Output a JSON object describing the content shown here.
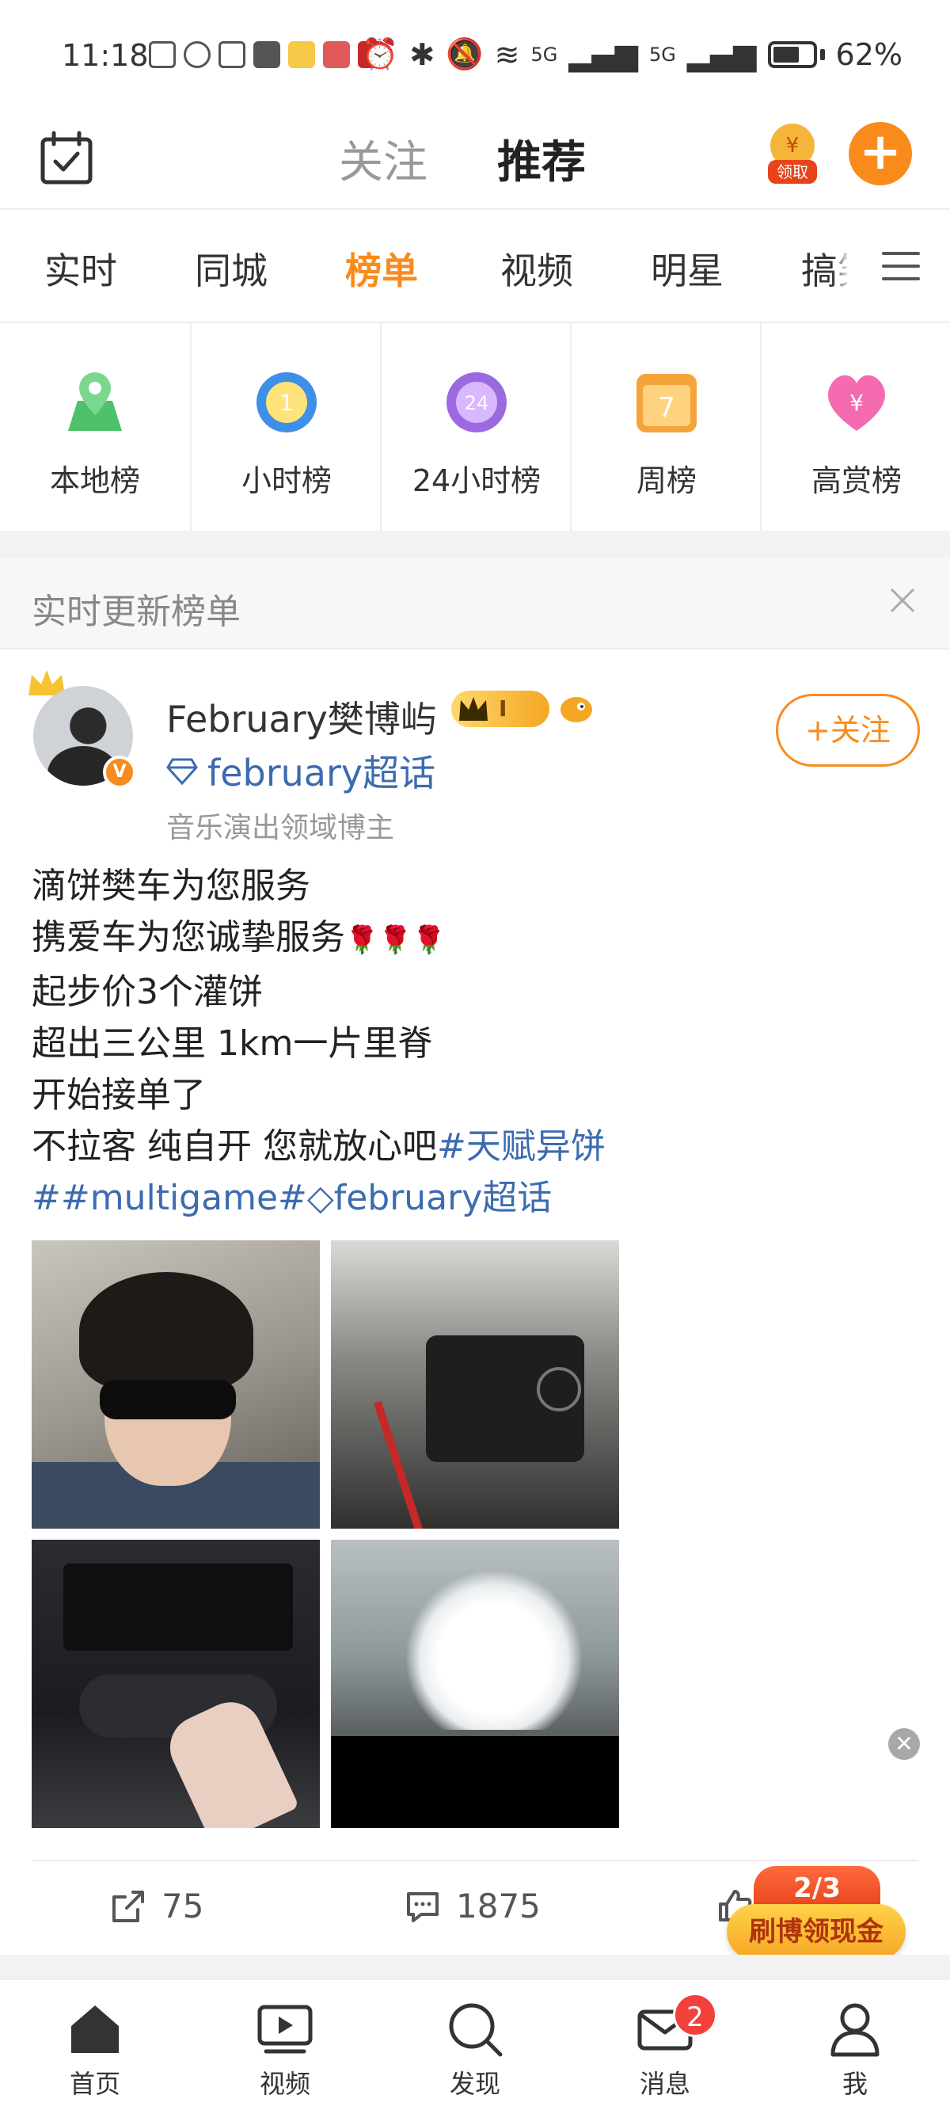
{
  "status_bar": {
    "time": "11:18",
    "battery": "62%",
    "signal1": "5G",
    "signal2": "5G"
  },
  "header": {
    "tab_follow": "关注",
    "tab_recommend": "推荐",
    "coin_label": "领取",
    "accent_color": "#f98b1d"
  },
  "categories": [
    "实时",
    "同城",
    "榜单",
    "视频",
    "明星",
    "搞笑"
  ],
  "active_category": "榜单",
  "ranks": [
    {
      "label": "本地榜",
      "icon": "location-pin-icon"
    },
    {
      "label": "小时榜",
      "icon": "hour-clock-icon"
    },
    {
      "label": "24小时榜",
      "icon": "24h-clock-icon"
    },
    {
      "label": "周榜",
      "icon": "calendar-7-icon"
    },
    {
      "label": "高赏榜",
      "icon": "heart-yen-icon"
    }
  ],
  "realtime": {
    "title": "实时更新榜单"
  },
  "post": {
    "author": "February樊博屿",
    "level_badge": "I",
    "supertopic": "february超话",
    "meta": "音乐演出领域博主",
    "follow_label": "+关注",
    "text_lines": [
      "滴饼樊车为您服务",
      "携爱车为您诚挚服务",
      "起步价3个灌饼",
      "超出三公里 1km一片里脊",
      "开始接单了",
      "不拉客 纯自开 您就放心吧"
    ],
    "topic1": "#天赋异饼",
    "topic2": "##multigame#",
    "topic3": "february超话",
    "images": [
      "selfie-photo",
      "engine-photo",
      "car-dashboard-photo",
      "dog-photo"
    ]
  },
  "actions": {
    "repost_count": "75",
    "comment_count": "1875"
  },
  "promo": {
    "progress": "2/3",
    "label": "刷博领现金"
  },
  "bottom_nav": [
    {
      "label": "首页"
    },
    {
      "label": "视频"
    },
    {
      "label": "发现"
    },
    {
      "label": "消息",
      "badge": "2"
    },
    {
      "label": "我"
    }
  ]
}
